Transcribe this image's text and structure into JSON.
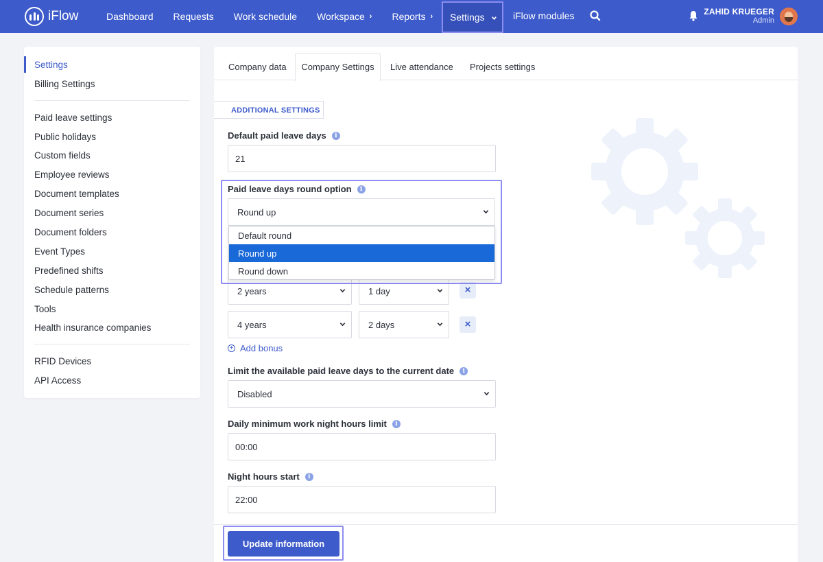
{
  "app": {
    "name": "iFlow"
  },
  "nav": {
    "items": [
      {
        "label": "Dashboard",
        "has_chevron": false
      },
      {
        "label": "Requests",
        "has_chevron": false
      },
      {
        "label": "Work schedule",
        "has_chevron": false
      },
      {
        "label": "Workspace",
        "has_chevron": true
      },
      {
        "label": "Reports",
        "has_chevron": true
      }
    ],
    "settings_label": "Settings",
    "modules_label": "iFlow modules",
    "search_icon": "search-icon",
    "notifications_icon": "bell-icon"
  },
  "user": {
    "name": "ZAHID KRUEGER",
    "role": "Admin"
  },
  "sidebar": {
    "group1": [
      "Settings",
      "Billing Settings"
    ],
    "group2": [
      "Paid leave settings",
      "Public holidays",
      "Custom fields",
      "Employee reviews",
      "Document templates",
      "Document series",
      "Document folders",
      "Event Types",
      "Predefined shifts",
      "Schedule patterns",
      "Tools",
      "Health insurance companies"
    ],
    "group3": [
      "RFID Devices",
      "API Access"
    ],
    "active": "Settings"
  },
  "tabs": [
    "Company data",
    "Company Settings",
    "Live attendance",
    "Projects settings"
  ],
  "active_tab": "Company Settings",
  "subtab": "ADDITIONAL SETTINGS",
  "form": {
    "default_paid_leave": {
      "label": "Default paid leave days",
      "value": "21"
    },
    "round_option": {
      "label": "Paid leave days round option",
      "value": "Round up",
      "options": [
        "Default round",
        "Round up",
        "Round down"
      ],
      "selected": "Round up"
    },
    "bonus_rows": [
      {
        "years": "2 years",
        "days": "1 day"
      },
      {
        "years": "4 years",
        "days": "2 days"
      }
    ],
    "add_bonus_label": "Add bonus",
    "limit_to_date": {
      "label": "Limit the available paid leave days to the current date",
      "value": "Disabled"
    },
    "night_hours_limit": {
      "label": "Daily minimum work night hours limit",
      "value": "00:00"
    },
    "night_hours_start": {
      "label": "Night hours start",
      "value": "22:00"
    }
  },
  "update_button": "Update information",
  "colors": {
    "primary": "#3d5bcb",
    "highlight": "#8d8cf0",
    "selected_option": "#1a69d8"
  }
}
